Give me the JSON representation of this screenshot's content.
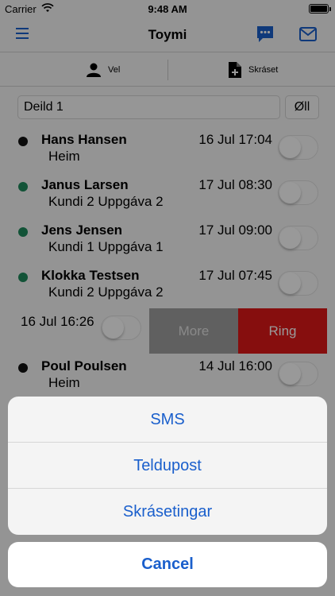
{
  "status_bar": {
    "carrier": "Carrier",
    "time": "9:48 AM",
    "battery_level": 1.0
  },
  "navbar": {
    "title": "Toymi",
    "menu_icon": "hamburger-icon",
    "chat_icon": "chat-icon",
    "mail_icon": "mail-icon",
    "accent": "#1a5fcc"
  },
  "segment": {
    "vel_label": "Vel",
    "skraset_label": "Skráset"
  },
  "filter": {
    "value": "Deild 1",
    "button_label": "Øll"
  },
  "rows": [
    {
      "name": "Hans Hansen",
      "sub": "Heim",
      "date": "16 Jul 17:04",
      "status_color": "#111111"
    },
    {
      "name": "Janus Larsen",
      "sub": "Kundi 2 Uppgáva 2",
      "date": "17 Jul 08:30",
      "status_color": "#1e8a5c"
    },
    {
      "name": "Jens Jensen",
      "sub": "Kundi 1 Uppgáva 1",
      "date": "17 Jul 09:00",
      "status_color": "#1e8a5c"
    },
    {
      "name": "Klokka Testsen",
      "sub": "Kundi 2 Uppgáva 2",
      "date": "17 Jul 07:45",
      "status_color": "#1e8a5c"
    }
  ],
  "swiped_row": {
    "date": "16 Jul 16:26",
    "more_label": "More",
    "ring_label": "Ring"
  },
  "last_row": {
    "name": "Poul Poulsen",
    "sub": "Heim",
    "date": "14 Jul 16:00",
    "status_color": "#111111"
  },
  "action_sheet": {
    "options": [
      "SMS",
      "Teldupost",
      "Skrásetingar"
    ],
    "cancel_label": "Cancel"
  }
}
